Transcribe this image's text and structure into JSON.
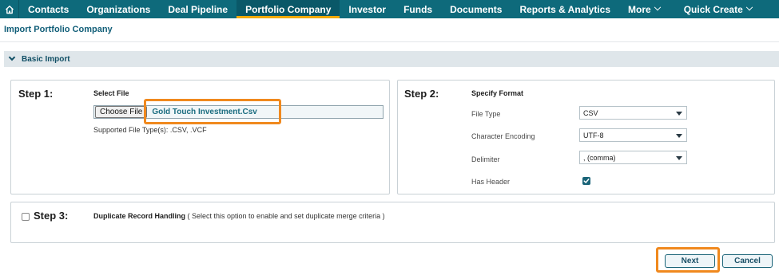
{
  "nav": {
    "items": [
      {
        "label": "Contacts"
      },
      {
        "label": "Organizations"
      },
      {
        "label": "Deal Pipeline"
      },
      {
        "label": "Portfolio Company"
      },
      {
        "label": "Investor"
      },
      {
        "label": "Funds"
      },
      {
        "label": "Documents"
      },
      {
        "label": "Reports & Analytics"
      },
      {
        "label": "More"
      },
      {
        "label": "Quick Create"
      }
    ],
    "active": "Portfolio Company"
  },
  "page": {
    "title": "Import Portfolio Company",
    "section_label": "Basic Import"
  },
  "step1": {
    "label": "Step 1:",
    "heading": "Select File",
    "choose_button": "Choose File",
    "file_name": "Gold Touch Investment.Csv",
    "supported_types": "Supported File Type(s): .CSV, .VCF"
  },
  "step2": {
    "label": "Step 2:",
    "heading": "Specify Format",
    "file_type_label": "File Type",
    "file_type_value": "CSV",
    "encoding_label": "Character Encoding",
    "encoding_value": "UTF-8",
    "delimiter_label": "Delimiter",
    "delimiter_value": ", (comma)",
    "has_header_label": "Has Header",
    "has_header_checked": true
  },
  "step3": {
    "label": "Step 3:",
    "heading": "Duplicate Record Handling",
    "description": " ( Select this option to enable and set duplicate merge criteria )",
    "checked": false
  },
  "actions": {
    "next_label": "Next",
    "cancel_label": "Cancel"
  },
  "colors": {
    "nav_bg": "#0e6a7b",
    "active_underline": "#f2a900",
    "highlight": "#f0891e",
    "accent": "#1a6478"
  }
}
